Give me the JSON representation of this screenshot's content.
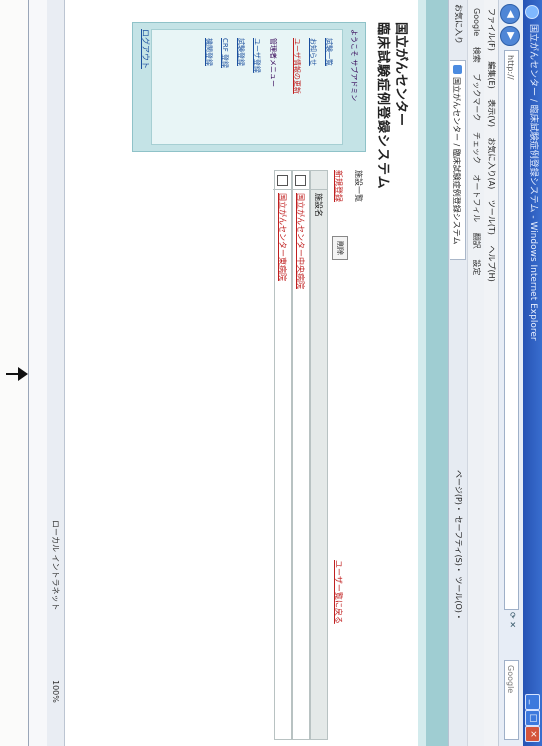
{
  "window": {
    "title": "国立がんセンター / 臨床試験症例登録システム - Windows Internet Explorer",
    "minimize": "_",
    "maximize": "□",
    "close": "×"
  },
  "addressbar": {
    "url": "http://",
    "search_placeholder": "Google"
  },
  "menubar": {
    "items": [
      "ファイル(F)",
      "編集(E)",
      "表示(V)",
      "お気に入り(A)",
      "ツール(T)",
      "ヘルプ(H)"
    ]
  },
  "google_toolbar": {
    "label": "Google",
    "items": [
      "検索",
      "ブックマーク",
      "チェック",
      "オートフィル",
      "翻訳",
      "設定"
    ]
  },
  "tabbar": {
    "favorites": "お気に入り",
    "tab_label": "国立がんセンター / 臨床試験症例登録システム",
    "tools": "ページ(P)・ セーフティ(S)・ ツール(O)・"
  },
  "page": {
    "logo_line1": "国立がんセンター",
    "logo_line2": "臨床試験症例登録システム",
    "sidebar": {
      "welcome": "ようこそ サブアドミン",
      "nav_items": [
        "試験一覧",
        "お知らせ",
        "ユーザ情報の更新"
      ],
      "section_title": "管理者メニュー",
      "admin_items": [
        "ユーザ登録",
        "試験登録",
        "CRF 登録",
        "機関登録"
      ],
      "logout": "ログアウト"
    },
    "breadcrumb": "施設一覧",
    "new_link": "新規登録",
    "delete_button": "削除",
    "back_link": "ユーザー覧に戻る",
    "table": {
      "header": "施設名",
      "rows": [
        "国立がんセンター中央病院",
        "国立がんセンター東病院"
      ]
    }
  },
  "statusbar": {
    "zone": "ローカル イントラネット",
    "zoom": "100%"
  }
}
